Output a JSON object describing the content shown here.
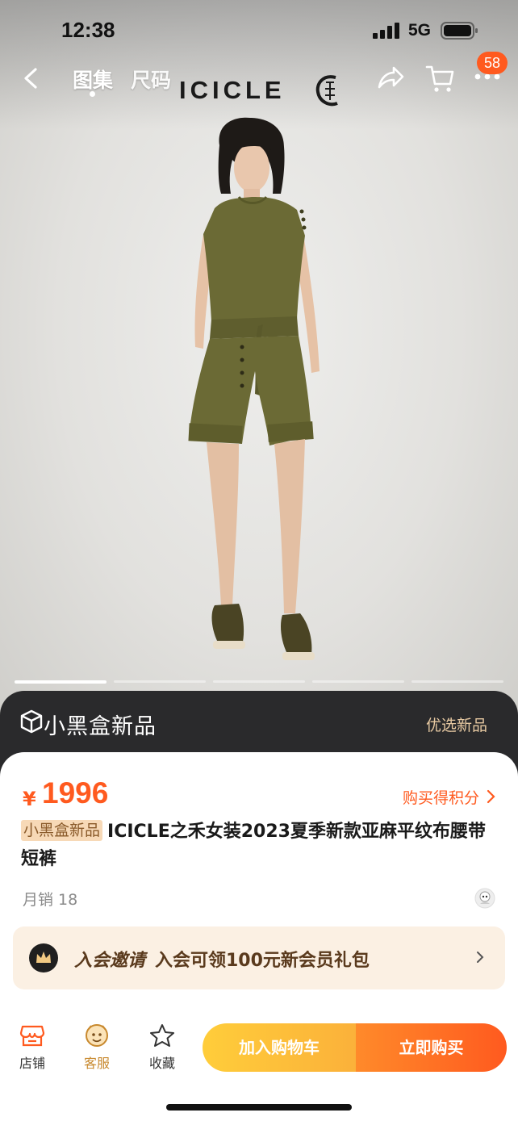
{
  "status_bar": {
    "time": "12:38",
    "network": "5G"
  },
  "nav": {
    "tabs": [
      {
        "label": "图集",
        "active": true
      },
      {
        "label": "尺码",
        "active": false
      }
    ],
    "brand": "ICICLE",
    "more_badge": "58"
  },
  "gallery": {
    "image_count": 5,
    "active_index": 0,
    "subject": "model wearing olive linen sleeveless top and belted shorts"
  },
  "promo_band": {
    "title": "小黑盒新品",
    "right_label": "优选新品"
  },
  "product": {
    "currency": "¥",
    "price": "1996",
    "points_link": "购买得积分",
    "tag": "小黑盒新品",
    "title": "ICICLE之禾女装2023夏季新款亚麻平纹布腰带短裤",
    "monthly_sales": "月销 18"
  },
  "member_banner": {
    "tag": "入会邀请",
    "text": "入会可领100元新会员礼包"
  },
  "bottom_bar": {
    "store_label": "店铺",
    "service_label": "客服",
    "favorite_label": "收藏",
    "add_to_cart": "加入购物车",
    "buy_now": "立即购买"
  },
  "colors": {
    "accent": "#ff5a1f",
    "cart_button": "#fbb13a",
    "member_bg": "#fbf0e3",
    "dark_band": "#2a2a2c",
    "garment": "#6b6a35"
  }
}
